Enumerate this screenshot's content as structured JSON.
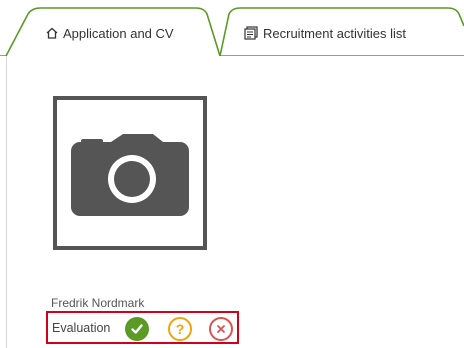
{
  "tabs": [
    {
      "label": "Application and CV",
      "icon": "home-icon",
      "active": true
    },
    {
      "label": "Recruitment activities list",
      "icon": "document-list-icon",
      "active": false
    }
  ],
  "photo": {
    "icon": "camera-icon"
  },
  "candidate": {
    "name": "Fredrik Nordmark"
  },
  "evaluation": {
    "label": "Evaluation",
    "options": [
      {
        "icon": "check-icon",
        "color": "#5a9a25"
      },
      {
        "icon": "question-icon",
        "symbol": "?",
        "color": "#f0a30a"
      },
      {
        "icon": "close-icon",
        "color": "#d9534f"
      }
    ]
  },
  "colors": {
    "tab_border": "#5a9a25",
    "highlight": "#d0021b"
  }
}
